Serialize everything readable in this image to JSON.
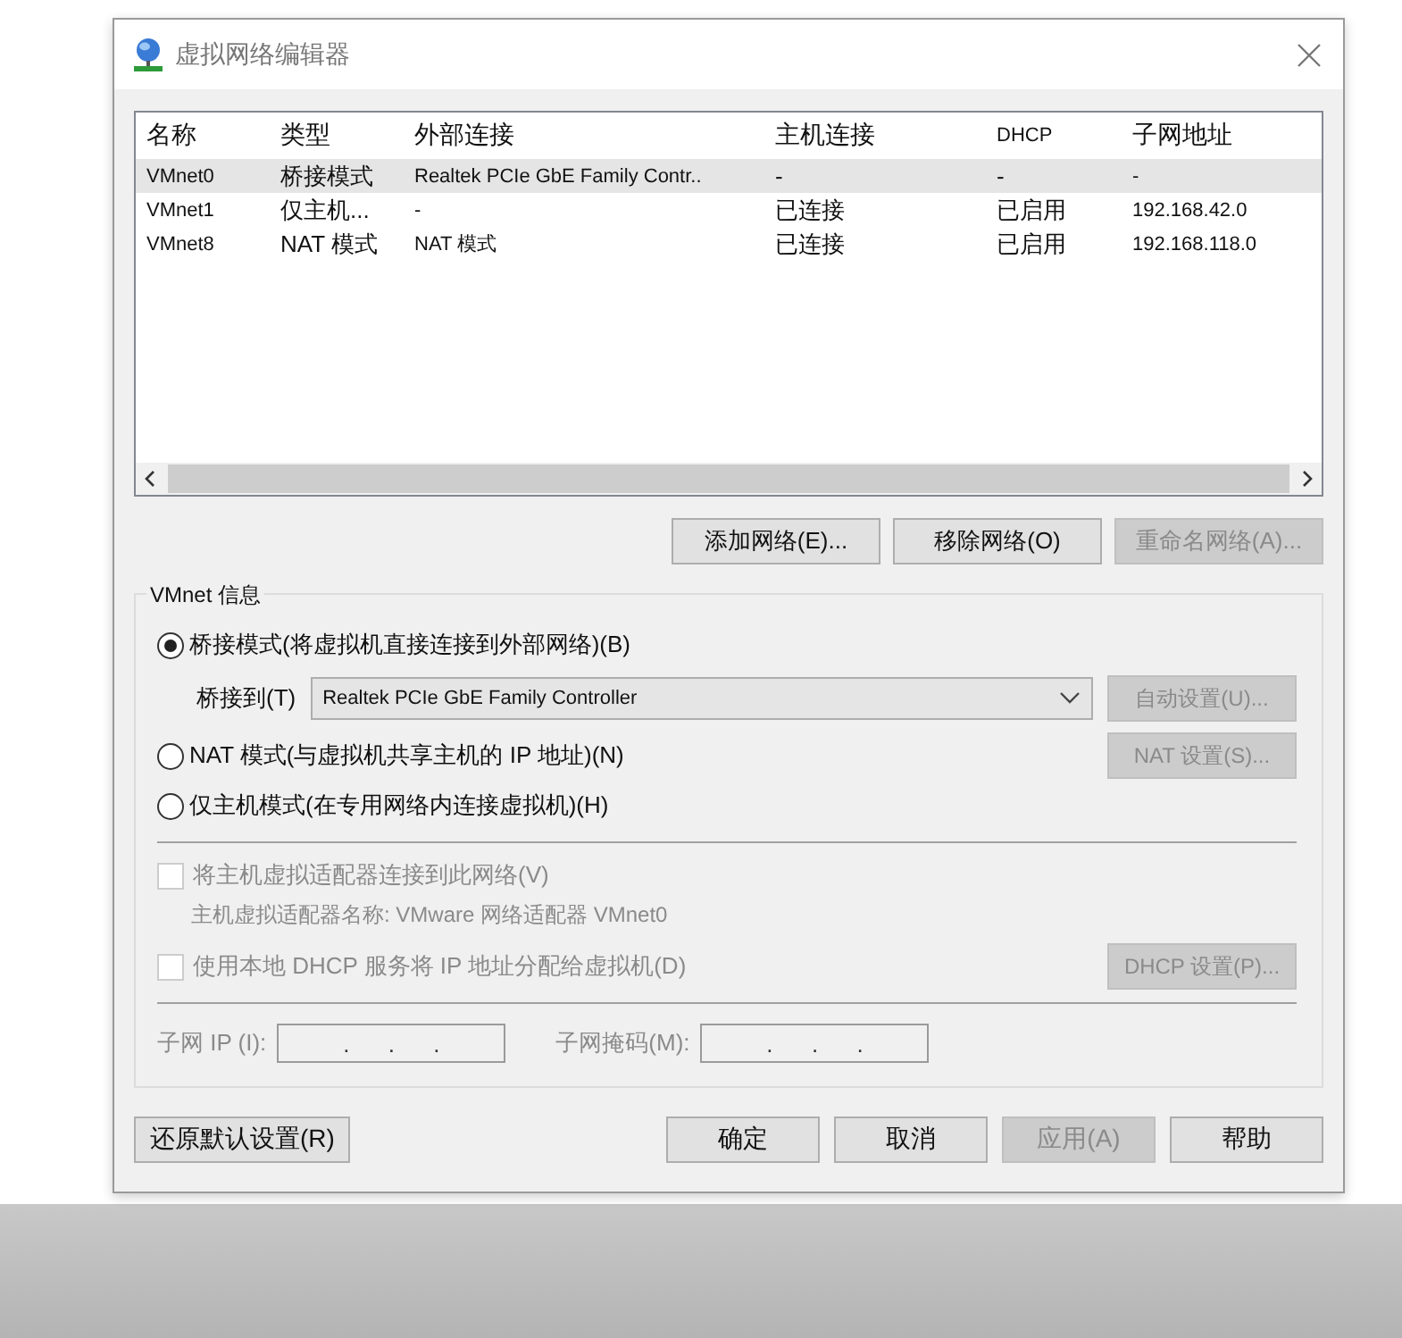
{
  "window": {
    "title": "虚拟网络编辑器"
  },
  "table": {
    "columns": [
      "名称",
      "类型",
      "外部连接",
      "主机连接",
      "DHCP",
      "子网地址"
    ],
    "rows": [
      {
        "cells": [
          "VMnet0",
          "桥接模式",
          "Realtek PCIe GbE Family Contr..",
          "-",
          "-",
          "-"
        ],
        "selected": true
      },
      {
        "cells": [
          "VMnet1",
          "仅主机...",
          "-",
          "已连接",
          "已启用",
          "192.168.42.0"
        ],
        "selected": false
      },
      {
        "cells": [
          "VMnet8",
          "NAT 模式",
          "NAT 模式",
          "已连接",
          "已启用",
          "192.168.118.0"
        ],
        "selected": false
      }
    ]
  },
  "table_actions": [
    {
      "label": "添加网络(E)...",
      "disabled": false
    },
    {
      "label": "移除网络(O)",
      "disabled": false
    },
    {
      "label": "重命名网络(A)...",
      "disabled": true
    }
  ],
  "vmnet_info": {
    "title": "VMnet 信息",
    "modes": [
      {
        "kind": "bridged",
        "label": "桥接模式(将虚拟机直接连接到外部网络)(B)",
        "selected": true
      },
      {
        "kind": "nat",
        "label": "NAT 模式(与虚拟机共享主机的 IP 地址)(N)",
        "selected": false
      },
      {
        "kind": "host",
        "label": "仅主机模式(在专用网络内连接虚拟机)(H)",
        "selected": false
      }
    ],
    "bridge_to": {
      "label": "桥接到(T)",
      "value": "Realtek PCIe GbE Family Controller",
      "button": {
        "label": "自动设置(U)...",
        "disabled": true
      }
    },
    "nat_button": {
      "label": "NAT 设置(S)...",
      "disabled": true
    },
    "host_adapter": {
      "label": "将主机虚拟适配器连接到此网络(V)",
      "checked": false,
      "disabled": true,
      "note": "主机虚拟适配器名称: VMware 网络适配器 VMnet0"
    },
    "dhcp": {
      "label": "使用本地 DHCP 服务将 IP 地址分配给虚拟机(D)",
      "checked": false,
      "disabled": true,
      "button": {
        "label": "DHCP 设置(P)...",
        "disabled": true
      }
    },
    "subnet_ip": {
      "label": "子网 IP (I):",
      "value": ".      .      .",
      "disabled": true
    },
    "subnet_mask": {
      "label": "子网掩码(M):",
      "value": ".      .      .",
      "disabled": true
    }
  },
  "buttons": [
    {
      "label": "还原默认设置(R)",
      "disabled": false
    },
    {
      "label": "确定",
      "disabled": false
    },
    {
      "label": "取消",
      "disabled": false
    },
    {
      "label": "应用(A)",
      "disabled": true
    },
    {
      "label": "帮助",
      "disabled": false
    }
  ]
}
